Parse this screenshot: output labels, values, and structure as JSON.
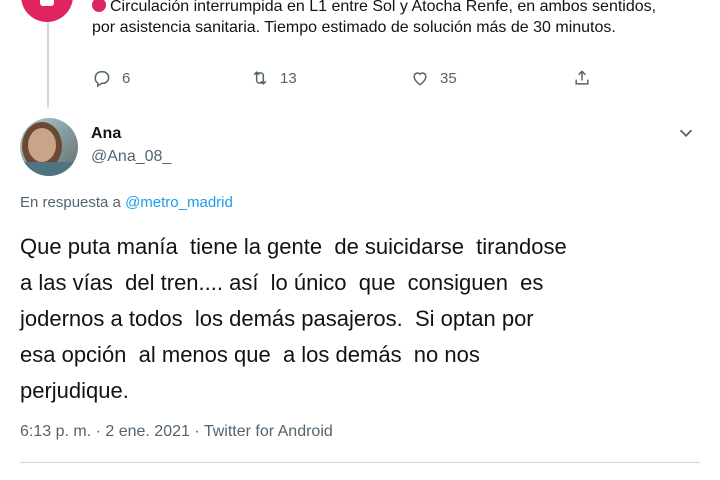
{
  "previous_tweet": {
    "text": "Circulación interrumpida en L1 entre Sol y Atocha Renfe, en ambos sentidos, por asistencia sanitaria. Tiempo estimado de solución más de 30 minutos.",
    "replies": "6",
    "retweets": "13",
    "likes": "35"
  },
  "tweet": {
    "author_name": "Ana",
    "author_handle": "@Ana_08_",
    "reply_prefix": "En respuesta a ",
    "reply_mention": "@metro_madrid",
    "text": "Que puta manía  tiene la gente  de suicidarse  tirandose\na las vías  del tren.... así  lo único  que  consiguen  es\njodernos a todos  los demás pasajeros.  Si optan por\nesa opción  al menos que  a los demás  no nos\nperjudique.",
    "meta": "6:13 p. m. · 2 ene. 2021 · Twitter for Android"
  },
  "icons": {
    "reply": "reply-icon",
    "retweet": "retweet-icon",
    "like": "heart-icon",
    "share": "share-icon",
    "more": "chevron-down-icon"
  },
  "colors": {
    "accent": "#1d9bf0",
    "alert": "#e0245e",
    "secondary_text": "#536471"
  }
}
